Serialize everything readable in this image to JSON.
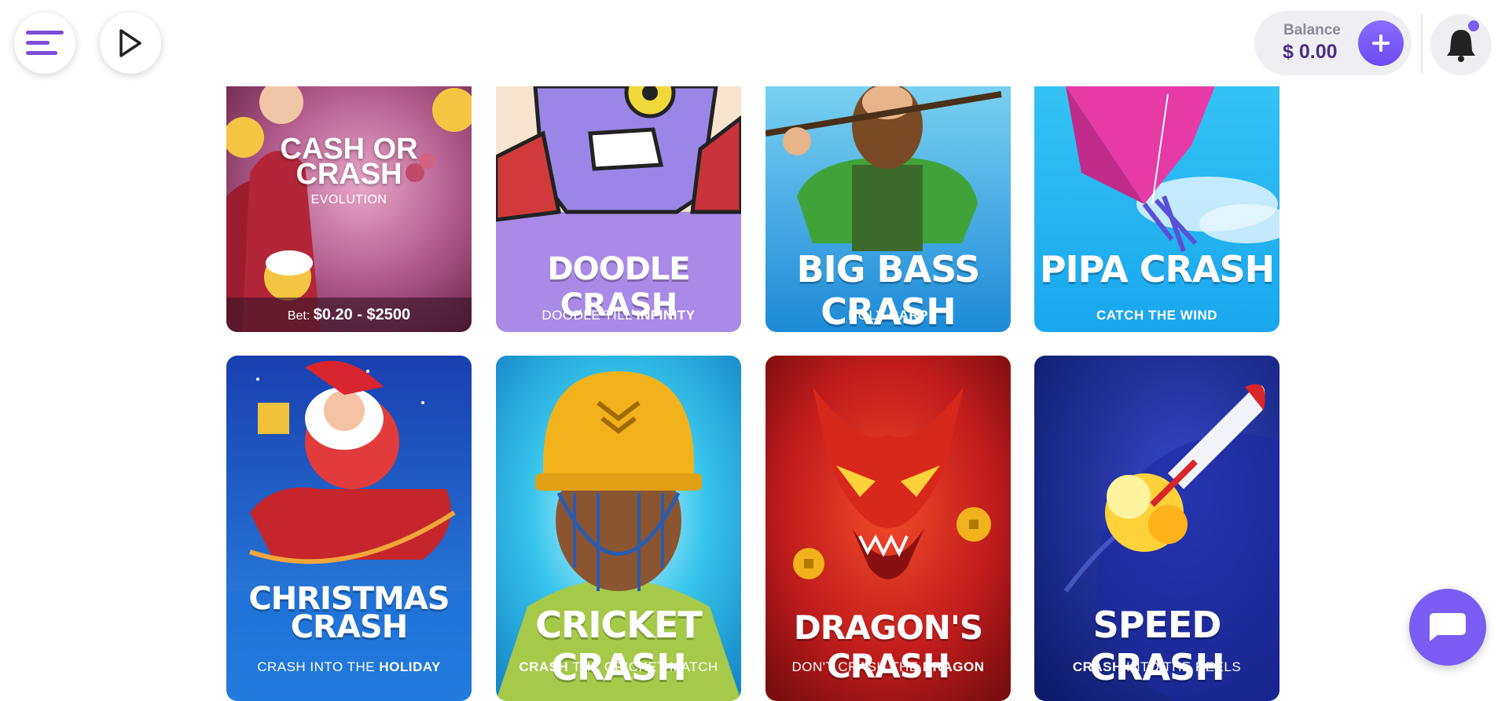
{
  "header": {
    "balance_label": "Balance",
    "balance_value": "$ 0.00",
    "notification_dot_color": "#7b5cf5",
    "accent_color": "#7b5cf5"
  },
  "games": [
    {
      "title_line1": "CASH OR",
      "title_line2": "CRASH",
      "provider": "EVOLUTION",
      "bet_label": "Bet:",
      "bet_value": "$0.20 - $2500"
    },
    {
      "title": "DOODLE CRASH",
      "sub_prefix": "DOODLE TILL ",
      "sub_bold": "INFINITY",
      "sub_suffix": ""
    },
    {
      "title": "BIG BASS CRASH",
      "sub_prefix": "HOLY ",
      "sub_bold": "CARP",
      "sub_suffix": ""
    },
    {
      "title": "PIPA CRASH",
      "sub_prefix": "",
      "sub_bold": "CATCH THE WIND",
      "sub_suffix": ""
    },
    {
      "title_line1": "CHRISTMAS",
      "title_line2": "CRASH",
      "sub_prefix": "CRASH INTO THE ",
      "sub_bold": "HOLIDAY",
      "sub_suffix": ""
    },
    {
      "title": "CRICKET CRASH",
      "sub_prefix": "",
      "sub_bold": "CRASH",
      "sub_suffix": " THE CRICKET MATCH"
    },
    {
      "title": "DRAGON'S CRASH",
      "sub_prefix": "DON'T CRASH THE ",
      "sub_bold": "DRAGON",
      "sub_suffix": ""
    },
    {
      "title": "SPEED CRASH",
      "sub_prefix": "",
      "sub_bold": "CRASH",
      "sub_suffix": " INTO THE REELS"
    }
  ],
  "icons": {
    "menu": "menu-icon",
    "play": "play-icon",
    "add": "plus-icon",
    "bell": "bell-icon",
    "chat": "chat-icon"
  }
}
